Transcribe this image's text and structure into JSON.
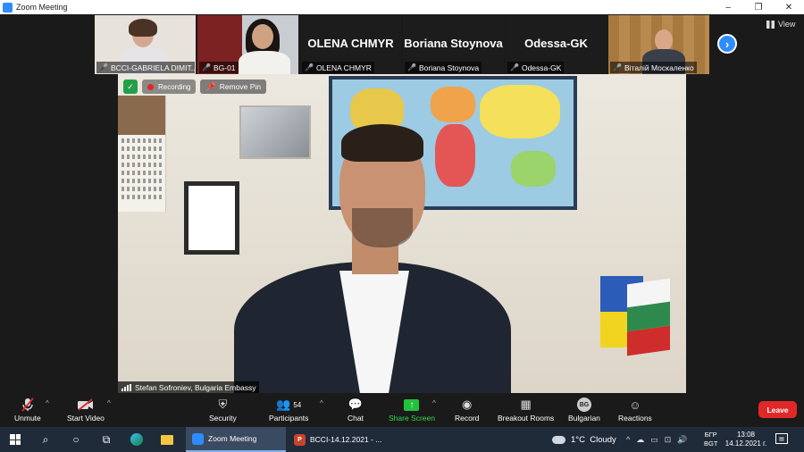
{
  "window": {
    "title": "Zoom Meeting",
    "controls": [
      "–",
      "❐",
      "✕"
    ]
  },
  "gallery": {
    "participants": [
      {
        "id": "p1",
        "label": "BCCI-GABRIELA DIMIT...",
        "big_name": "",
        "muted": true
      },
      {
        "id": "p2",
        "label": "BG-01",
        "big_name": "",
        "muted": true
      },
      {
        "id": "p3",
        "label": "OLENA CHMYR",
        "big_name": "OLENA CHMYR",
        "muted": true
      },
      {
        "id": "p4",
        "label": "Boriana Stoynova",
        "big_name": "Boriana Stoynova",
        "muted": true
      },
      {
        "id": "p5",
        "label": "Odessa-GK",
        "big_name": "Odessa-GK",
        "muted": true
      },
      {
        "id": "p6",
        "label": "Віталій Москаленко",
        "big_name": "",
        "muted": true
      }
    ],
    "next_icon": "›",
    "view_label": "View"
  },
  "main": {
    "recording_label": "Recording",
    "remove_pin_label": "Remove Pin",
    "speaker_label": "Stefan Sofroniev, Bulgaria Embassy"
  },
  "toolbar": {
    "unmute": "Unmute",
    "start_video": "Start Video",
    "security": "Security",
    "participants": "Participants",
    "participants_count": "54",
    "chat": "Chat",
    "share_screen": "Share Screen",
    "record": "Record",
    "breakout_rooms": "Breakout Rooms",
    "language": "Bulgarian",
    "language_badge": "BG",
    "reactions": "Reactions",
    "leave": "Leave"
  },
  "taskbar": {
    "apps": [
      {
        "label": "Zoom Meeting",
        "active": true
      },
      {
        "label": "BCCI-14.12.2021 - ...",
        "active": false
      }
    ],
    "weather": "1°C  Cloudy",
    "lang_top": "БГР",
    "lang_bottom": "BGT",
    "time": "13:08",
    "date": "14.12.2021 г."
  },
  "colors": {
    "accent": "#2d8cff",
    "leave": "#e02828",
    "share": "#23c13b",
    "mic_off": "#e02828"
  }
}
